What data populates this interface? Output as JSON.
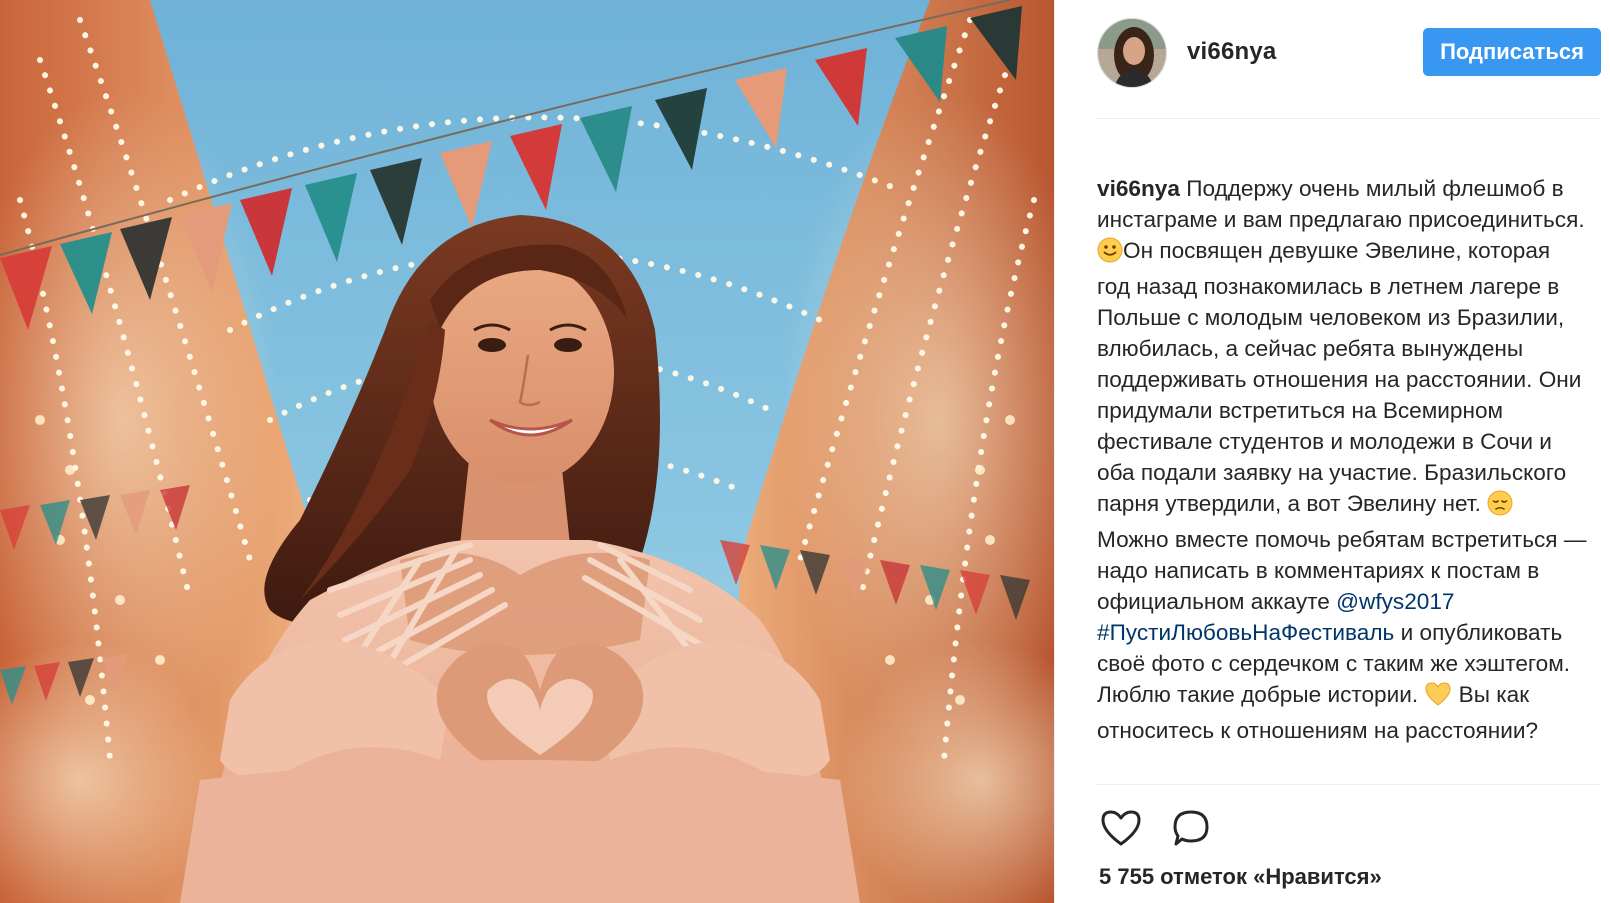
{
  "post": {
    "username": "vi66nya",
    "follow_label": "Подписаться",
    "caption": {
      "user": "vi66nya",
      "text_1": " Поддержу очень милый флешмоб в инстаграме и вам предлагаю присоединиться. ",
      "text_2": "Он посвящен девушке Эвелине, которая год назад познакомилась в летнем лагере в Польше с молодым человеком из Бразилии, влюбилась, а сейчас ребята вынуждены поддерживать отношения на расстоянии. Они придумали встретиться на Всемирном фестивале студентов и молодежи в Сочи и оба подали заявку на участие. Бразильского парня утвердили, а вот Эвелину нет. ",
      "text_3": " Можно вместе помочь ребятам встретиться — надо написать в комментариях к постам в официальном аккауте ",
      "mention": "@wfys2017",
      "hashtag": "#ПустиЛюбовьНаФестиваль",
      "text_4": " и опубликовать своё фото с сердечком с таким же хэштегом. Люблю такие добрые истории. ",
      "text_5": " Вы как относитесь к отношениям на расстоянии?"
    },
    "likes_text": "5 755 отметок «Нравится»",
    "icons": {
      "like": "heart-outline-icon",
      "comment": "comment-bubble-icon",
      "smile": "slightly-smiling-face-emoji",
      "sad": "pensive-face-emoji",
      "heart": "yellow-heart-emoji"
    },
    "colors": {
      "follow_button": "#3897f0",
      "text": "#262626",
      "link": "#003569"
    }
  }
}
